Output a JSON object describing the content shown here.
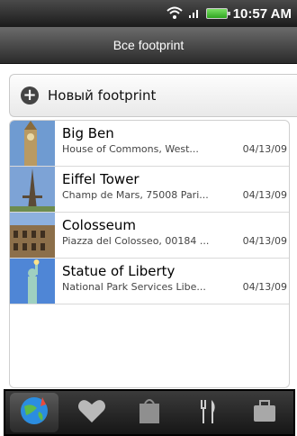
{
  "status": {
    "time": "10:57 AM"
  },
  "title": "Все footprint",
  "new_footprint_label": "Новый footprint",
  "items": [
    {
      "name": "Big Ben",
      "address": "House of Commons, West...",
      "date": "04/13/09"
    },
    {
      "name": "Eiffel Tower",
      "address": "Champ de Mars, 75008 Pari...",
      "date": "04/13/09"
    },
    {
      "name": "Colosseum",
      "address": "Piazza del Colosseo, 00184 ...",
      "date": "04/13/09"
    },
    {
      "name": "Statue of Liberty",
      "address": "National Park Services Libe...",
      "date": "04/13/09"
    }
  ],
  "tabs": [
    {
      "icon": "globe-icon",
      "active": true
    },
    {
      "icon": "heart-icon",
      "active": false
    },
    {
      "icon": "shopping-bag-icon",
      "active": false
    },
    {
      "icon": "fork-knife-icon",
      "active": false
    },
    {
      "icon": "briefcase-icon",
      "active": false
    }
  ]
}
